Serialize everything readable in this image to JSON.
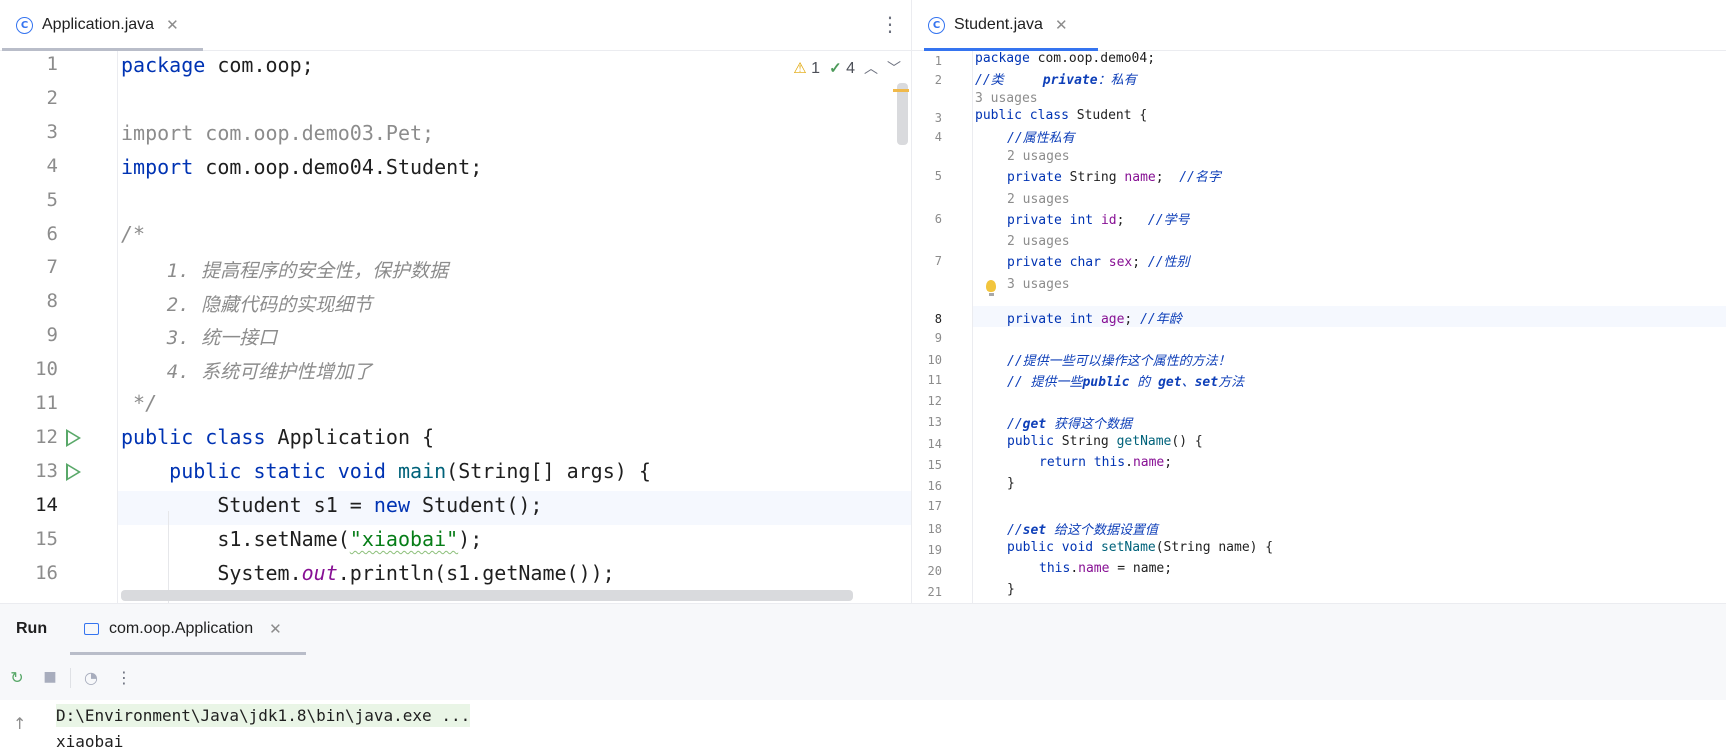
{
  "left_tab": {
    "icon": "C",
    "label": "Application.java",
    "close": "✕"
  },
  "left_menu": "⋮",
  "right_tab": {
    "icon": "C",
    "label": "Student.java",
    "close": "✕"
  },
  "inspections": {
    "warnings": "1",
    "ok": "4",
    "warn_icon": "warning-icon",
    "ok_icon": "check-icon"
  },
  "left_code": {
    "line_numbers": [
      "1",
      "2",
      "3",
      "4",
      "5",
      "6",
      "7",
      "8",
      "9",
      "10",
      "11",
      "12",
      "13",
      "14",
      "15",
      "16"
    ],
    "l1": {
      "kw": "package",
      "rest": " com.oop;"
    },
    "l3": {
      "text": "import com.oop.demo03.Pet;"
    },
    "l4": {
      "kw": "import",
      "rest": " com.oop.demo04.Student;"
    },
    "l6": "/*",
    "l7": "    1. 提高程序的安全性，保护数据",
    "l8": "    2. 隐藏代码的实现细节",
    "l9": "    3. 统一接口",
    "l10": "    4. 系统可维护性增加了",
    "l11": " */",
    "l12": {
      "kw1": "public",
      "kw2": "class",
      "rest": " Application {"
    },
    "l13": {
      "kw1": "public",
      "kw2": "static",
      "kw3": "void",
      "mth": "main",
      "rest": "(String[] args) {"
    },
    "l14": {
      "a": "Student s1 = ",
      "kw": "new",
      "b": " Student();"
    },
    "l15": {
      "a": "s1.setName(",
      "str": "\"xiaobai\"",
      "b": ");"
    },
    "l16": {
      "a": "System.",
      "stat": "out",
      "b": ".println(s1.getName());"
    }
  },
  "right_code": {
    "line_numbers": [
      "1",
      "2",
      "3",
      "4",
      "5",
      "6",
      "7",
      "8",
      "9",
      "10",
      "11",
      "12",
      "13",
      "14",
      "15",
      "16",
      "17",
      "18",
      "19",
      "20",
      "21"
    ],
    "l1": {
      "kw": "package",
      "rest": " com.oop.demo04;"
    },
    "l2": {
      "a": "//类     ",
      "b": "private",
      "c": "：私有"
    },
    "u3": "3 usages",
    "l3": {
      "kw1": "public",
      "kw2": "class",
      "rest": " Student {"
    },
    "l4": "//属性私有",
    "u5": "2 usages",
    "l5": {
      "kw": "private",
      "type": " String ",
      "fld": "name",
      "semi": ";  ",
      "cm": "//名字"
    },
    "u6": "2 usages",
    "l6": {
      "kw": "private",
      "kw2": "int",
      "fld": "id",
      "semi": ";   ",
      "cm": "//学号"
    },
    "u7": "2 usages",
    "l7": {
      "kw": "private",
      "kw2": "char",
      "fld": "sex",
      "semi": "; ",
      "cm": "//性别"
    },
    "u8": "3 usages",
    "l8": {
      "kw": "private",
      "kw2": "int",
      "fld": "age",
      "semi": "; ",
      "cm": "//年龄"
    },
    "l10": "//提供一些可以操作这个属性的方法！",
    "l11": {
      "a": "// 提供一些",
      "b": "public",
      "c": " 的 ",
      "d": "get",
      "e": "、",
      "f": "set",
      "g": "方法"
    },
    "l13": {
      "a": "//",
      "b": "get",
      "c": " 获得这个数据"
    },
    "l14": {
      "kw": "public",
      "type": " String ",
      "mth": "getName",
      "rest": "() {"
    },
    "l15": {
      "kw": "return",
      "kw2": "this",
      "dot": ".",
      "fld": "name",
      "semi": ";"
    },
    "l16": "}",
    "l18": {
      "a": "//",
      "b": "set",
      "c": " 给这个数据设置值"
    },
    "l19": {
      "kw": "public",
      "kw2": "void",
      "mth": "setName",
      "rest": "(String name) {"
    },
    "l20": {
      "kw": "this",
      "dot": ".",
      "fld": "name",
      "rest": " = name;"
    },
    "l21": "}"
  },
  "run_panel": {
    "title": "Run",
    "config_label": "com.oop.Application",
    "config_close": "✕",
    "toolbar": {
      "rerun": "↻",
      "stop": "■",
      "dump": "◔",
      "more": "⋮"
    },
    "console": [
      "D:\\Environment\\Java\\jdk1.8\\bin\\java.exe ...",
      "xiaobai"
    ],
    "up": "↑"
  }
}
